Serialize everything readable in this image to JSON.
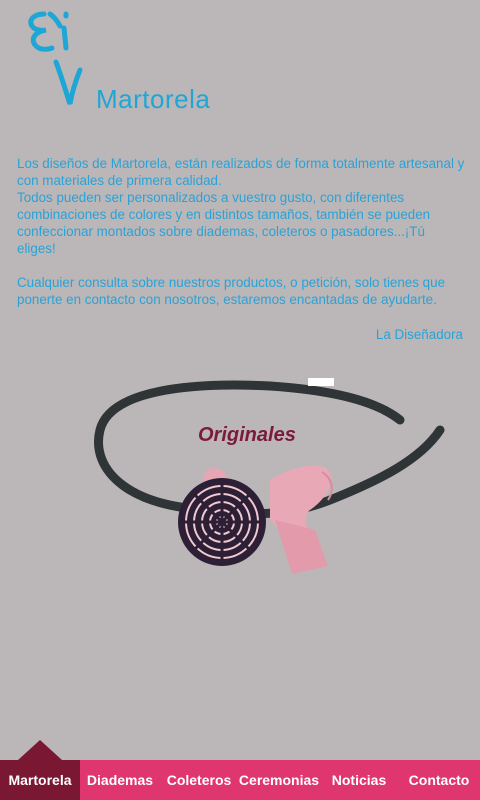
{
  "brand": {
    "name": "Martorela"
  },
  "intro": {
    "p1": "Los diseños de Martorela, están realizados de forma totalmente artesanal y con materiales de primera calidad.",
    "p2": "Todos pueden ser personalizados a vuestro gusto, con diferentes combinaciones de colores y en distintos tamaños, también se pueden confeccionar montados sobre diademas, coleteros o pasadores...¡Tú eliges!",
    "p3": "Cualquier consulta sobre nuestros productos, o petición, solo tienes que ponerte en contacto con nosotros, estaremos encantadas de ayudarte."
  },
  "signature": "La Diseñadora",
  "product": {
    "title": "Originales"
  },
  "nav": {
    "items": [
      {
        "label": "Martorela",
        "active": true
      },
      {
        "label": "Diademas",
        "active": false
      },
      {
        "label": "Coleteros",
        "active": false
      },
      {
        "label": "Ceremonias",
        "active": false
      },
      {
        "label": "Noticias",
        "active": false
      },
      {
        "label": "Contacto",
        "active": false
      }
    ]
  },
  "colors": {
    "background": "#bbb7b8",
    "text": "#2aa2d6",
    "nav": "#e0366f",
    "nav_active": "#7a1733",
    "product_title": "#7c1a3a"
  }
}
